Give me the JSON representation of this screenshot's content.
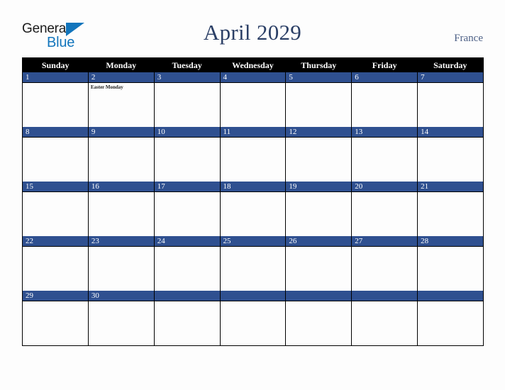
{
  "logo": {
    "word_one": "General",
    "word_two": "Blue",
    "flag_icon": "blue-triangle-flag",
    "word_one_color": "#1b1b1b",
    "word_two_color": "#1275bc"
  },
  "header": {
    "title": "April 2029",
    "country": "France",
    "title_color": "#2b3f66",
    "country_color": "#4c5f85"
  },
  "calendar": {
    "month": "April",
    "year": "2029",
    "weekday_headers": [
      "Sunday",
      "Monday",
      "Tuesday",
      "Wednesday",
      "Thursday",
      "Friday",
      "Saturday"
    ],
    "header_bg": "#000000",
    "header_text_color": "#ffffff",
    "day_bar_bg": "#2f5090",
    "day_bar_text_color": "#ffffff",
    "cell_bg": "#fdfdfd",
    "grid_line_color": "#000000",
    "weeks": [
      {
        "days": [
          {
            "number": "1",
            "events": []
          },
          {
            "number": "2",
            "events": [
              "Easter Monday"
            ]
          },
          {
            "number": "3",
            "events": []
          },
          {
            "number": "4",
            "events": []
          },
          {
            "number": "5",
            "events": []
          },
          {
            "number": "6",
            "events": []
          },
          {
            "number": "7",
            "events": []
          }
        ]
      },
      {
        "days": [
          {
            "number": "8",
            "events": []
          },
          {
            "number": "9",
            "events": []
          },
          {
            "number": "10",
            "events": []
          },
          {
            "number": "11",
            "events": []
          },
          {
            "number": "12",
            "events": []
          },
          {
            "number": "13",
            "events": []
          },
          {
            "number": "14",
            "events": []
          }
        ]
      },
      {
        "days": [
          {
            "number": "15",
            "events": []
          },
          {
            "number": "16",
            "events": []
          },
          {
            "number": "17",
            "events": []
          },
          {
            "number": "18",
            "events": []
          },
          {
            "number": "19",
            "events": []
          },
          {
            "number": "20",
            "events": []
          },
          {
            "number": "21",
            "events": []
          }
        ]
      },
      {
        "days": [
          {
            "number": "22",
            "events": []
          },
          {
            "number": "23",
            "events": []
          },
          {
            "number": "24",
            "events": []
          },
          {
            "number": "25",
            "events": []
          },
          {
            "number": "26",
            "events": []
          },
          {
            "number": "27",
            "events": []
          },
          {
            "number": "28",
            "events": []
          }
        ]
      },
      {
        "days": [
          {
            "number": "29",
            "events": []
          },
          {
            "number": "30",
            "events": []
          },
          {
            "number": "",
            "events": []
          },
          {
            "number": "",
            "events": []
          },
          {
            "number": "",
            "events": []
          },
          {
            "number": "",
            "events": []
          },
          {
            "number": "",
            "events": []
          }
        ]
      }
    ]
  }
}
